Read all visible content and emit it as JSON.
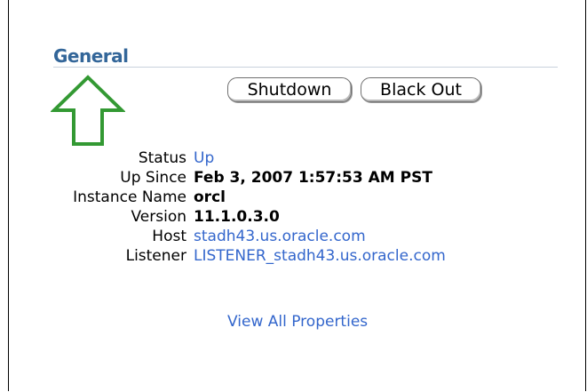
{
  "section": {
    "title": "General"
  },
  "buttons": {
    "shutdown": "Shutdown",
    "blackout": "Black Out"
  },
  "properties": [
    {
      "label": "Status",
      "value": "Up"
    },
    {
      "label": "Up Since",
      "value": "Feb 3, 2007 1:57:53 AM PST"
    },
    {
      "label": "Instance Name",
      "value": "orcl"
    },
    {
      "label": "Version",
      "value": "11.1.0.3.0"
    },
    {
      "label": "Host",
      "value": "stadh43.us.oracle.com"
    },
    {
      "label": "Listener",
      "value": "LISTENER_stadh43.us.oracle.com"
    }
  ],
  "links": {
    "view_all": "View All Properties"
  },
  "colors": {
    "title": "#336699",
    "link": "#3366cc",
    "arrow": "#339933"
  },
  "icons": {
    "callout": "up-arrow-icon"
  }
}
